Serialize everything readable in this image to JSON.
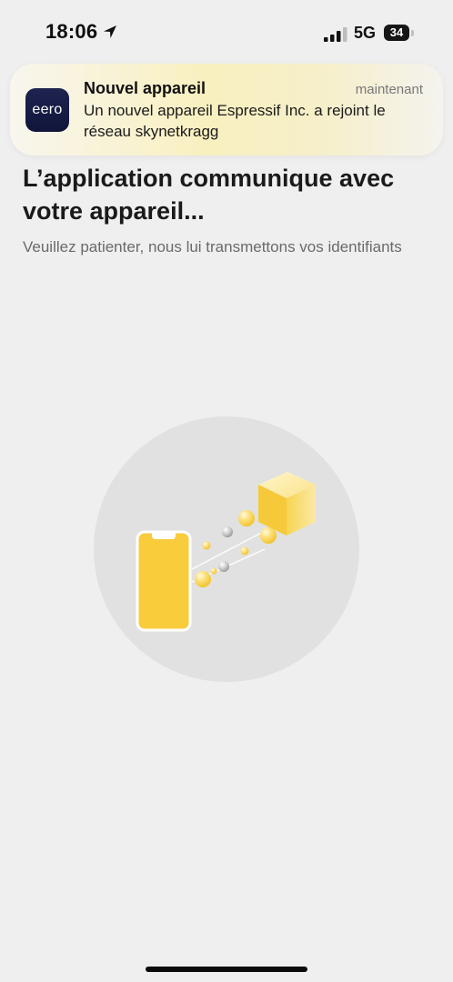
{
  "status_bar": {
    "time": "18:06",
    "network": "5G",
    "battery_level": "34",
    "battery_fraction": 0.34,
    "icons": [
      "location-arrow-icon",
      "cellular-signal-icon",
      "battery-icon"
    ]
  },
  "notification": {
    "app_name": "eero",
    "title": "Nouvel appareil",
    "time": "maintenant",
    "body": "Un nouvel appareil Espressif Inc. a rejoint le réseau skynetkragg"
  },
  "main": {
    "title": "L’application communique avec votre appareil...",
    "subtitle": "Veuillez patienter, nous lui transmettons vos identifiants"
  },
  "colors": {
    "background": "#efefef",
    "accent_yellow": "#f7ca3d",
    "app_icon": "#161b44",
    "illustration_circle": "#e1e1e1"
  }
}
